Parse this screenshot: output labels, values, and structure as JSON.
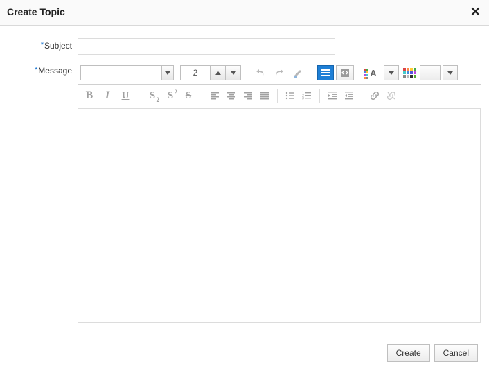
{
  "header": {
    "title": "Create Topic"
  },
  "form": {
    "subject_label": "Subject",
    "message_label": "Message",
    "subject_value": ""
  },
  "toolbar": {
    "font_size": "2"
  },
  "footer": {
    "create_label": "Create",
    "cancel_label": "Cancel"
  }
}
